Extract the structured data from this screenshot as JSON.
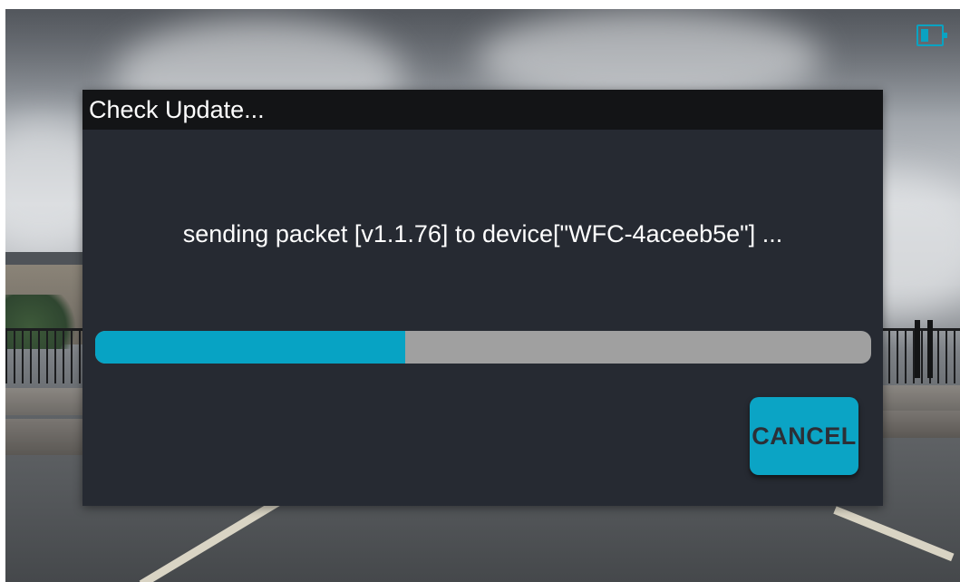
{
  "status_bar": {
    "battery_icon": "battery-low-icon",
    "battery_level": 0.3,
    "accent_color": "#0aa3c2"
  },
  "dialog": {
    "title": "Check Update...",
    "message": "sending packet [v1.1.76] to device[\"WFC-4aceeb5e\"] ...",
    "progress": 0.4,
    "cancel_label": "CANCEL",
    "colors": {
      "background": "#262a32",
      "header": "#131416",
      "progress_fill": "#07a3c4",
      "progress_track": "#a0a0a0",
      "button": "#0ba4c5"
    }
  }
}
